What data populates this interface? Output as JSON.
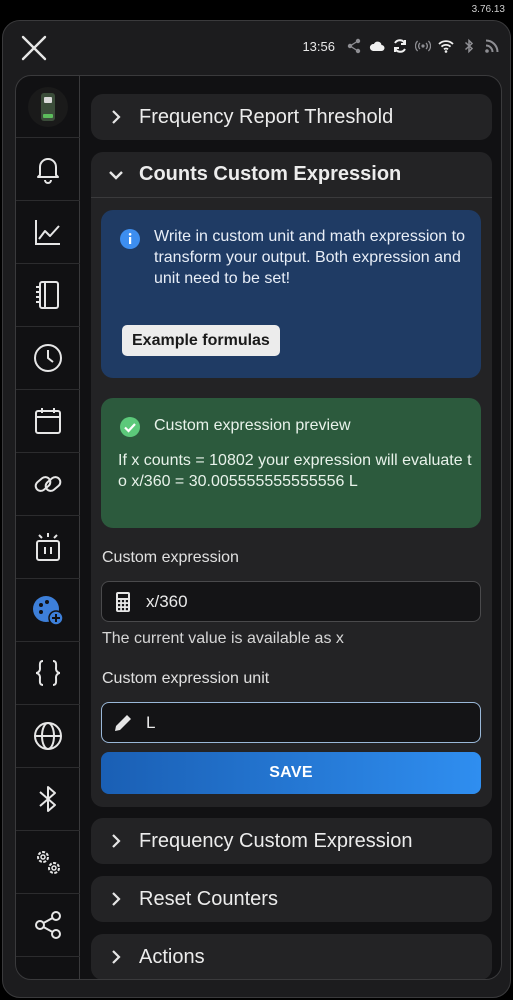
{
  "version": "3.76.13",
  "status_bar": {
    "time": "13:56",
    "icons": [
      "share-icon",
      "cloud-icon",
      "sync-icon",
      "broadcast-icon",
      "wifi-icon",
      "bluetooth-icon",
      "rss-icon"
    ]
  },
  "sidebar": {
    "items": [
      {
        "name": "device-image"
      },
      {
        "name": "bell-icon"
      },
      {
        "name": "chart-icon"
      },
      {
        "name": "device-icon"
      },
      {
        "name": "clock-icon"
      },
      {
        "name": "calendar-icon"
      },
      {
        "name": "link-icon"
      },
      {
        "name": "alarm-icon"
      },
      {
        "name": "palette-add-icon",
        "active": true
      },
      {
        "name": "braces-icon"
      },
      {
        "name": "globe-icon"
      },
      {
        "name": "bluetooth-icon"
      },
      {
        "name": "settings-icon"
      },
      {
        "name": "share-icon"
      }
    ]
  },
  "sections": {
    "frequency_report_threshold": "Frequency Report Threshold",
    "counts_custom_expression": "Counts Custom Expression",
    "frequency_custom_expression": "Frequency Custom Expression",
    "reset_counters": "Reset Counters",
    "actions": "Actions"
  },
  "info": {
    "text": "Write in custom unit and math expression to transform your output. Both expression and unit need to be set!",
    "example_button": "Example formulas"
  },
  "preview": {
    "title": "Custom expression preview",
    "text": "If x counts = 10802 your expression will evaluate to x/360 = 30.005555555555556 L"
  },
  "form": {
    "expression_label": "Custom expression",
    "expression_value": "x/360",
    "expression_hint": "The current value is available as x",
    "unit_label": "Custom expression unit",
    "unit_value": "L",
    "save_label": "SAVE"
  },
  "colors": {
    "info_bg": "#1f3b64",
    "preview_bg": "#2c5a3d",
    "accent": "#2f8ef0",
    "active_icon": "#3d7fd9"
  }
}
